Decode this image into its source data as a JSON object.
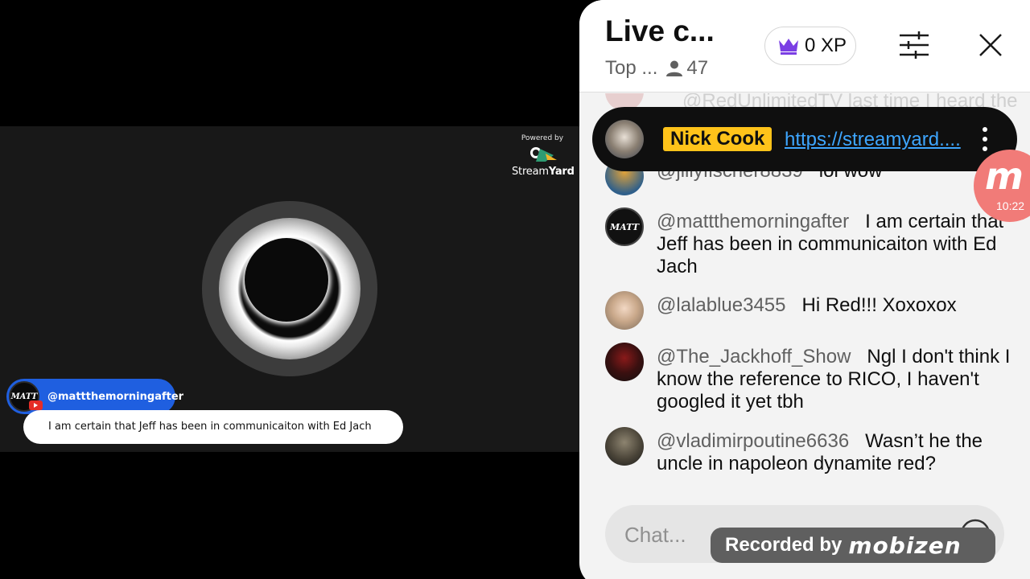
{
  "video": {
    "powered_label": "Powered by",
    "brand_prefix": "Stream",
    "brand_suffix": "Yard",
    "overlay": {
      "avatar_text": "MATT",
      "username": "@mattthemorningafter",
      "message": "I am certain that Jeff has been in communicaiton with Ed Jach"
    }
  },
  "chat": {
    "title": "Live c...",
    "subtitle": "Top ...",
    "viewer_count": "47",
    "xp_label": "0 XP",
    "faded_message": "@RedUnlimitedTV   last time I heard the",
    "pinned": {
      "name": "Nick Cook",
      "link": "https://streamyard...."
    },
    "messages": [
      {
        "author": "@jillyfischer8839",
        "text": "lol wow",
        "avatar_color": "#2f5f8a"
      },
      {
        "author": "@mattthemorningafter",
        "text": "I am certain that Jeff has been in communicaiton with Ed Jach",
        "avatar_color": "#111111",
        "avatar_text": "MATT"
      },
      {
        "author": "@lalablue3455",
        "text": "Hi Red!!! Xoxoxox",
        "avatar_color": "#c9a88a"
      },
      {
        "author": "@The_Jackhoff_Show",
        "text": "Ngl I don't think I know the reference to RICO, I haven't googled it yet tbh",
        "avatar_color": "#3a1010"
      },
      {
        "author": "@vladimirpoutine6636",
        "text": "Wasn’t he the uncle in napoleon dynamite red?",
        "avatar_color": "#4a4438"
      }
    ],
    "input_placeholder": "Chat...",
    "colors": {
      "pinned_name_bg": "#ffc31a",
      "link": "#3ea6ff",
      "xp_crown": "#7b3fe4"
    }
  },
  "mobizen": {
    "badge_letter": "m",
    "timer": "10:22",
    "recorded_label": "Recorded by",
    "recorded_brand": "mobizen"
  },
  "icons": [
    "streamyard-logo",
    "youtube-icon",
    "person-icon",
    "crown-icon",
    "filter-icon",
    "close-icon",
    "more-vert-icon",
    "emoji-icon"
  ]
}
